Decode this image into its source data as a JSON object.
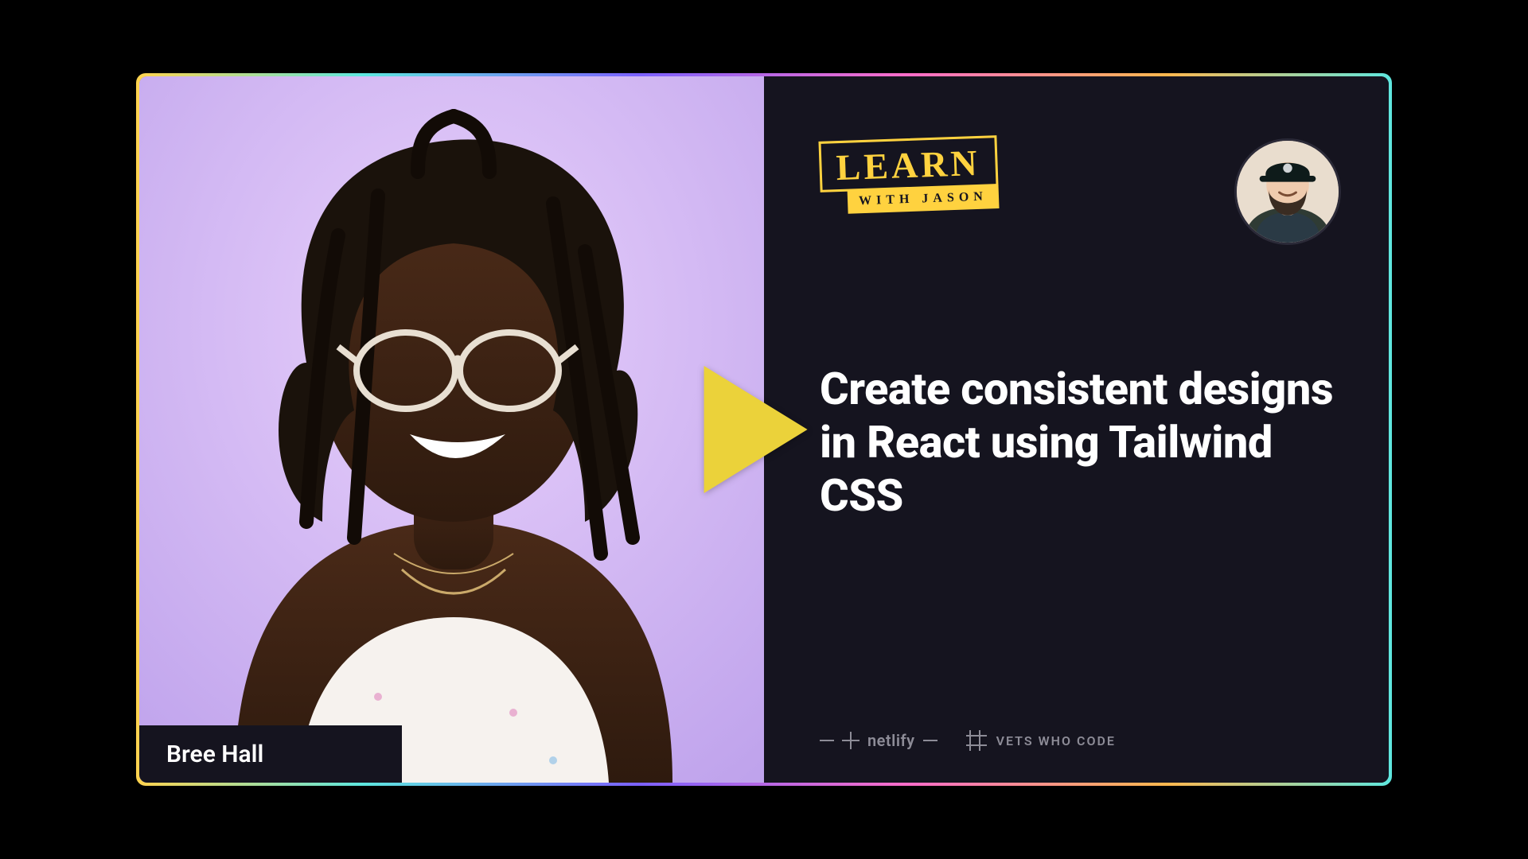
{
  "guest": {
    "name": "Bree Hall"
  },
  "brand": {
    "logo_top": "LEARN",
    "logo_bottom": "WITH JASON"
  },
  "episode": {
    "title": "Create consistent designs in React using Tailwind CSS"
  },
  "sponsors": {
    "netlify": "netlify",
    "vets": "VETS WHO CODE"
  },
  "colors": {
    "accent_yellow": "#ffd23f",
    "panel_dark": "#15141f",
    "text_light": "#ffffff",
    "muted": "#8d8c97"
  }
}
